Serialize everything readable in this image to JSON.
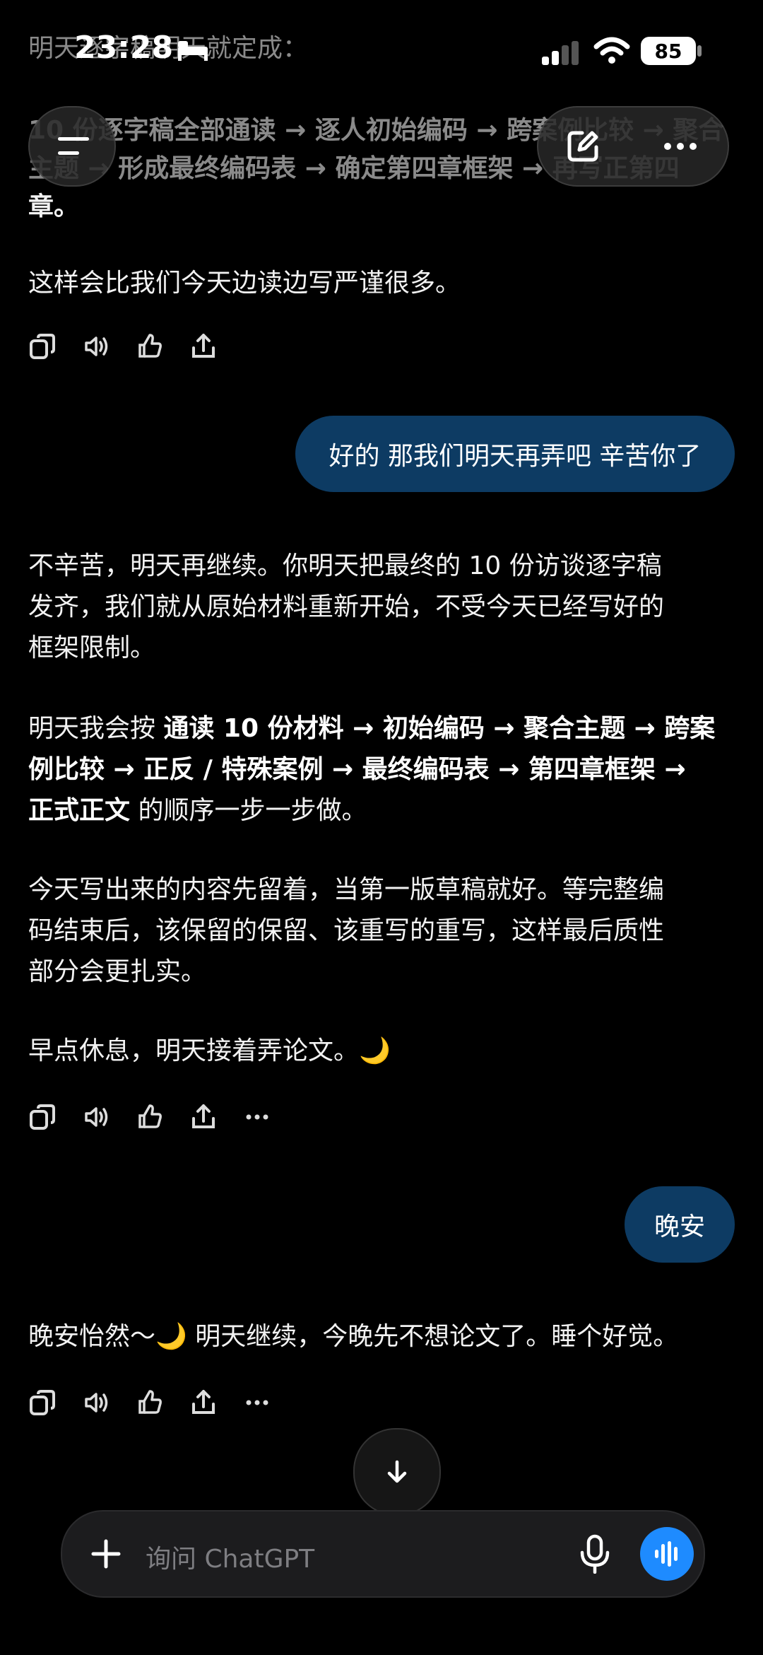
{
  "status": {
    "time": "23:28",
    "battery": "85"
  },
  "header": {
    "faded_line1": "明天逐字稿明天就定成：",
    "faded_line2": "10 份逐字稿全部通读 → 逐人初始编码 → 跨案例比较 → 聚合",
    "faded_line3": "主题 → 形成最终编码表 → 确定第四章框架 → 再写正第四",
    "faded_line4": "章。"
  },
  "message_a": "这样会比我们今天边读边写严谨很多。",
  "user_msg_1": "好的 那我们明天再弄吧 辛苦你了",
  "reply_1": {
    "p1_line1": "不辛苦，明天再继续。你明天把最终的 10 份访谈逐字稿",
    "p1_line2": "发齐，我们就从原始材料重新开始，不受今天已经写好的",
    "p1_line3": "框架限制。",
    "p2_prefix": "明天我会按 ",
    "p2_bold1": "通读 10 份材料 → 初始编码 → 聚合主题 → 跨案",
    "p2_bold2": "例比较 → 正反 / 特殊案例 → 最终编码表 → 第四章框架 →",
    "p2_bold3": "正式正文",
    "p2_suffix": " 的顺序一步一步做。",
    "p3_line1": "今天写出来的内容先留着，当第一版草稿就好。等完整编",
    "p3_line2": "码结束后，该保留的保留、该重写的重写，这样最后质性",
    "p3_line3": "部分会更扎实。",
    "p4": "早点休息，明天接着弄论文。🌙"
  },
  "user_msg_2": "晚安",
  "reply_2": "晚安怡然～🌙 明天继续，今晚先不想论文了。睡个好觉。",
  "composer": {
    "placeholder": "询问 ChatGPT"
  },
  "icons": {
    "copy": "copy-icon",
    "speak": "speaker-icon",
    "feedback": "thumbs-icon",
    "share": "share-icon",
    "more": "more-icon"
  },
  "colors": {
    "bubble": "#0d3b63",
    "voice_button": "#1e8bff",
    "background": "#000000"
  }
}
